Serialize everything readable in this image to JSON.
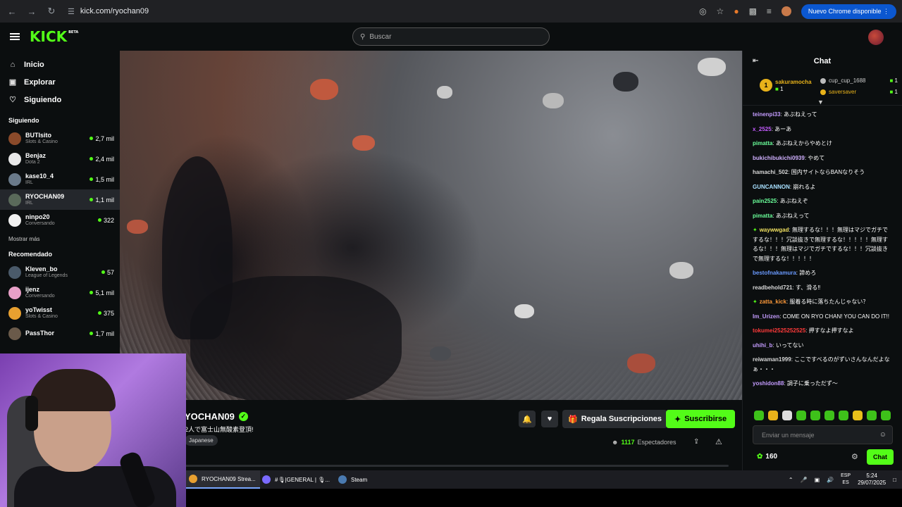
{
  "browser": {
    "url": "kick.com/ryochan09",
    "update_label": "Nuevo Chrome disponible"
  },
  "header": {
    "logo": "KICK",
    "logo_beta": "BETA",
    "search_placeholder": "Buscar"
  },
  "sidebar": {
    "nav": [
      {
        "label": "Inicio",
        "icon": "home-icon"
      },
      {
        "label": "Explorar",
        "icon": "compass-icon"
      },
      {
        "label": "Siguiendo",
        "icon": "heart-icon"
      }
    ],
    "following_title": "Siguiendo",
    "following": [
      {
        "name": "BUTIsito",
        "category": "Slots & Casino",
        "viewers": "2,7 mil",
        "color": "#8a4a2a"
      },
      {
        "name": "Benjaz",
        "category": "Dota 2",
        "viewers": "2,4 mil",
        "color": "#e8e8e8"
      },
      {
        "name": "kase10_4",
        "category": "IRL",
        "viewers": "1,5 mil",
        "color": "#6a7a8a"
      },
      {
        "name": "RYOCHAN09",
        "category": "IRL",
        "viewers": "1,1 mil",
        "color": "#5a6a5a"
      },
      {
        "name": "ninpo20",
        "category": "Conversando",
        "viewers": "322",
        "color": "#f0f0f0"
      }
    ],
    "show_more": "Mostrar más",
    "recommended_title": "Recomendado",
    "recommended": [
      {
        "name": "Kleven_bo",
        "category": "League of Legends",
        "viewers": "57",
        "color": "#4a5a6a"
      },
      {
        "name": "ijenz",
        "category": "Conversando",
        "viewers": "5,1 mil",
        "color": "#e8a0c8"
      },
      {
        "name": "yoTwisst",
        "category": "Slots & Casino",
        "viewers": "375",
        "color": "#e8a030"
      },
      {
        "name": "PassThor",
        "category": "",
        "viewers": "1,7 mil",
        "color": "#6a5a4a"
      }
    ]
  },
  "stream": {
    "channel": "YOCHAN09",
    "title": "2人で富士山無酸素登頂!",
    "tag": "Japanese",
    "gift_label": "Regala Suscripciones",
    "subscribe_label": "Suscribirse",
    "viewers_count": "1117",
    "viewers_label": "Espectadores"
  },
  "chat": {
    "title": "Chat",
    "top_gifter": {
      "rank": "1",
      "name": "sakuramocha",
      "count": "1"
    },
    "gifters": [
      {
        "name": "cup_cup_1688",
        "count": "1",
        "color": "#cccccc"
      },
      {
        "name": "saversaver",
        "count": "1",
        "color": "#e8b21a"
      }
    ],
    "messages": [
      {
        "user": "teinenpi33",
        "color": "#c49cff",
        "text": "あぶねえって",
        "pin": false
      },
      {
        "user": "x_2525",
        "color": "#c45cff",
        "text": "あーあ",
        "pin": false
      },
      {
        "user": "pimatta",
        "color": "#6aff9a",
        "text": "あぶねえからやめとけ",
        "pin": false
      },
      {
        "user": "bukichibukichi0939",
        "color": "#d0b0ff",
        "text": "やめて",
        "pin": false
      },
      {
        "user": "hamachi_502",
        "color": "#d8d8d8",
        "text": "国内サイトならBANなりそう",
        "pin": false
      },
      {
        "user": "GUNCANNON",
        "color": "#a8e0ff",
        "text": "崩れるよ",
        "pin": false
      },
      {
        "user": "pain2525",
        "color": "#6aff9a",
        "text": "あぶねえぞ",
        "pin": false
      },
      {
        "user": "pimatta",
        "color": "#6aff9a",
        "text": "あぶねえって",
        "pin": false
      },
      {
        "user": "waywwgad",
        "color": "#f0e060",
        "text": "無理するな！！！無理はマジでガチでするな！！！冗談抜きで無理するな！！！！！無理するな！！！無理はマジでガチでするな！！！冗談抜きで無理するな！！！！！",
        "pin": true
      },
      {
        "user": "bestofnakamura",
        "color": "#6a9aff",
        "text": "諦めろ",
        "pin": false
      },
      {
        "user": "readbehold721",
        "color": "#d8d8d8",
        "text": "す、滑る‼",
        "pin": false
      },
      {
        "user": "zatta_kick",
        "color": "#ff9a3a",
        "text": "服着る時に落ちたんじゃない？",
        "pin": true
      },
      {
        "user": "Im_Urizen",
        "color": "#c49cff",
        "text": "COME ON RYO CHAN! YOU CAN DO IT!!",
        "pin": false
      },
      {
        "user": "tokumei2525252525",
        "color": "#ff3a3a",
        "text": "押すなよ押すなよ",
        "pin": false
      },
      {
        "user": "uhihi_b",
        "color": "#c49cff",
        "text": "いってない",
        "pin": false
      },
      {
        "user": "reiwaman1999",
        "color": "#d8d8d8",
        "text": "ここですべるのがずいさんなんだよなぁ・・・",
        "pin": false
      },
      {
        "user": "yoshidon88",
        "color": "#c49cff",
        "text": "調子に乗っただず〜",
        "pin": false
      }
    ],
    "input_placeholder": "Enviar un mensaje",
    "points": "160",
    "send_label": "Chat"
  },
  "taskbar": {
    "tasks": [
      {
        "label": "RYOCHAN09 Strea...",
        "icon": "chrome-icon",
        "color": "#e8a030"
      },
      {
        "label": "#🎙|GENERAL | 🎙...",
        "icon": "discord-icon",
        "color": "#7a6aff"
      },
      {
        "label": "Steam",
        "icon": "steam-icon",
        "color": "#4a7ab0"
      }
    ],
    "lang_top": "ESP",
    "lang_bottom": "ES",
    "time": "5:24",
    "date": "29/07/2025"
  }
}
